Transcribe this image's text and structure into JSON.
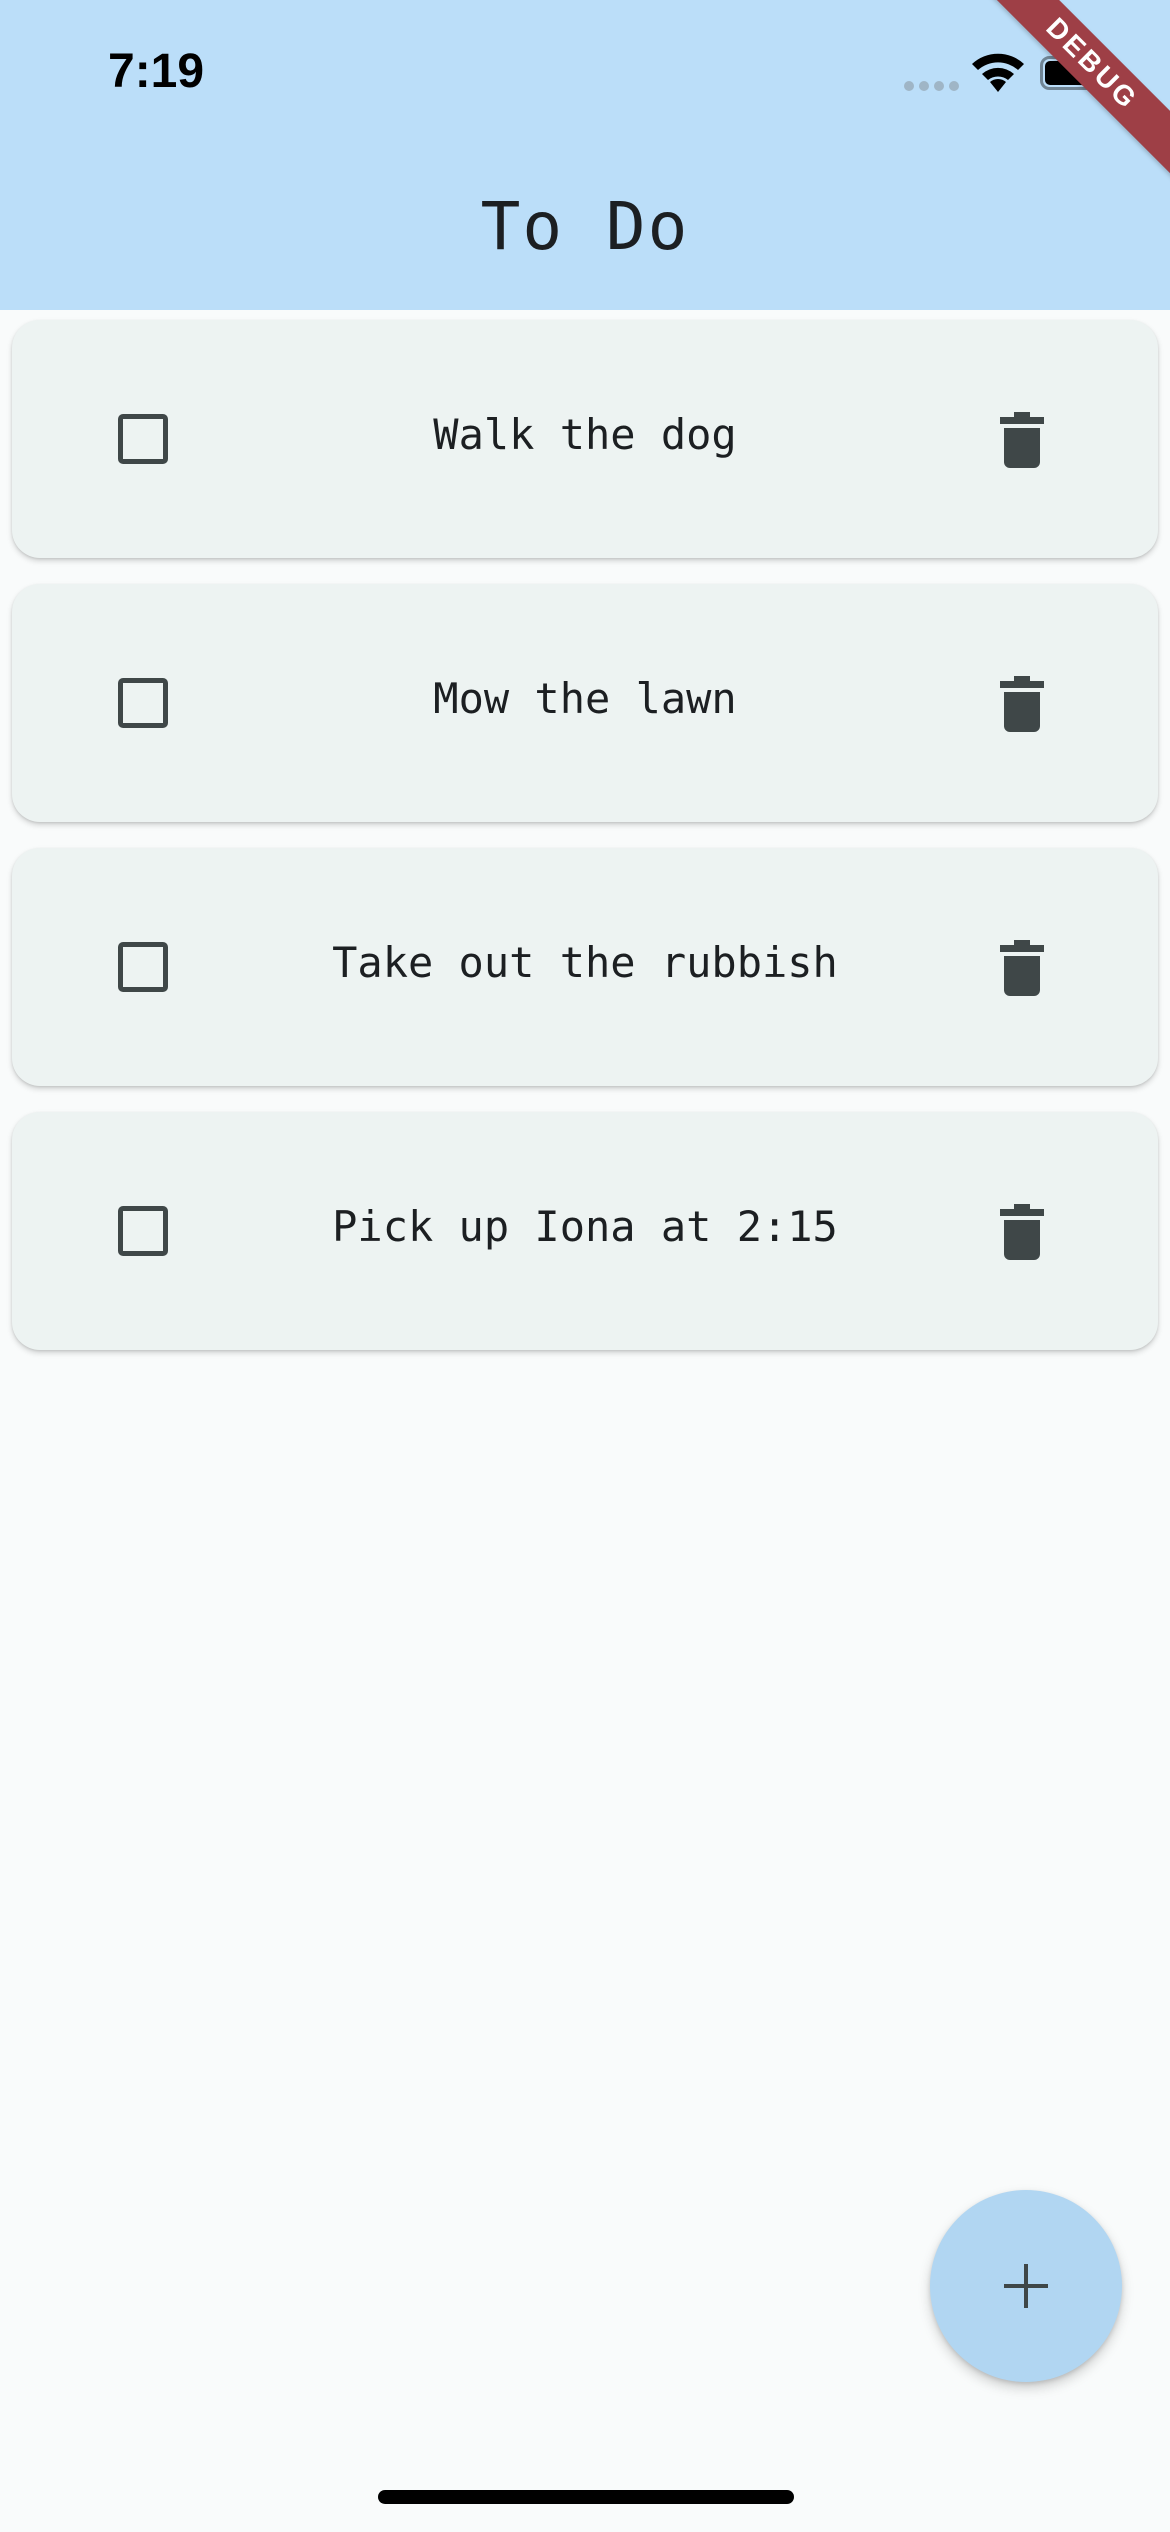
{
  "status_bar": {
    "time": "7:19"
  },
  "app_bar": {
    "title": "To Do",
    "debug_banner": "DEBUG"
  },
  "todos": [
    {
      "text": "Walk the dog",
      "checked": false
    },
    {
      "text": "Mow the lawn",
      "checked": false
    },
    {
      "text": "Take out the rubbish",
      "checked": false
    },
    {
      "text": "Pick up Iona at 2:15",
      "checked": false
    }
  ],
  "icons": {
    "checkbox": "checkbox-outline-icon",
    "delete": "trash-icon",
    "add": "plus-icon"
  },
  "colors": {
    "app_bar_bg": "#bbdef9",
    "card_bg": "#edf3f2",
    "page_bg": "#f9fbfb",
    "fab_bg": "#b1d6f2",
    "icon": "#3f4748",
    "debug_ribbon": "#9e3f46"
  }
}
